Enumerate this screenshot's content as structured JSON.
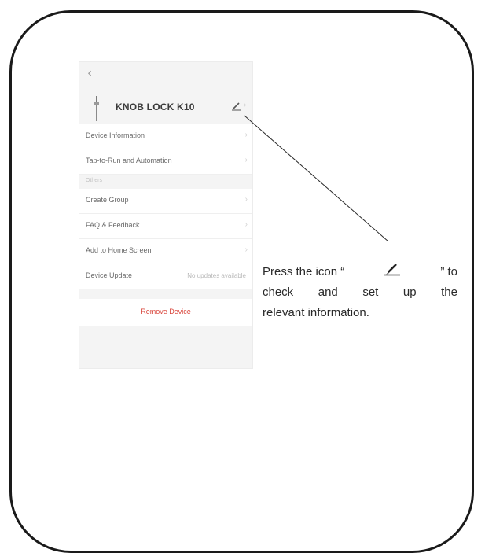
{
  "app": {
    "back_icon": "chevron-left-icon",
    "device_name": "KNOB LOCK K10",
    "edit_icon": "pencil-icon"
  },
  "menu": {
    "items": [
      {
        "label": "Device Information"
      },
      {
        "label": "Tap-to-Run and Automation"
      }
    ],
    "section_label": "Others",
    "other_items": [
      {
        "label": "Create Group"
      },
      {
        "label": "FAQ & Feedback"
      },
      {
        "label": "Add to Home Screen"
      },
      {
        "label": "Device Update",
        "value": "No updates available"
      }
    ],
    "remove_label": "Remove Device"
  },
  "caption": {
    "line1_before": "Press the icon “",
    "line1_after": "” to",
    "line2": "check and set up the",
    "line3": "relevant information."
  },
  "colors": {
    "remove_text": "#d9443a",
    "frame_border": "#1a1a1a"
  }
}
